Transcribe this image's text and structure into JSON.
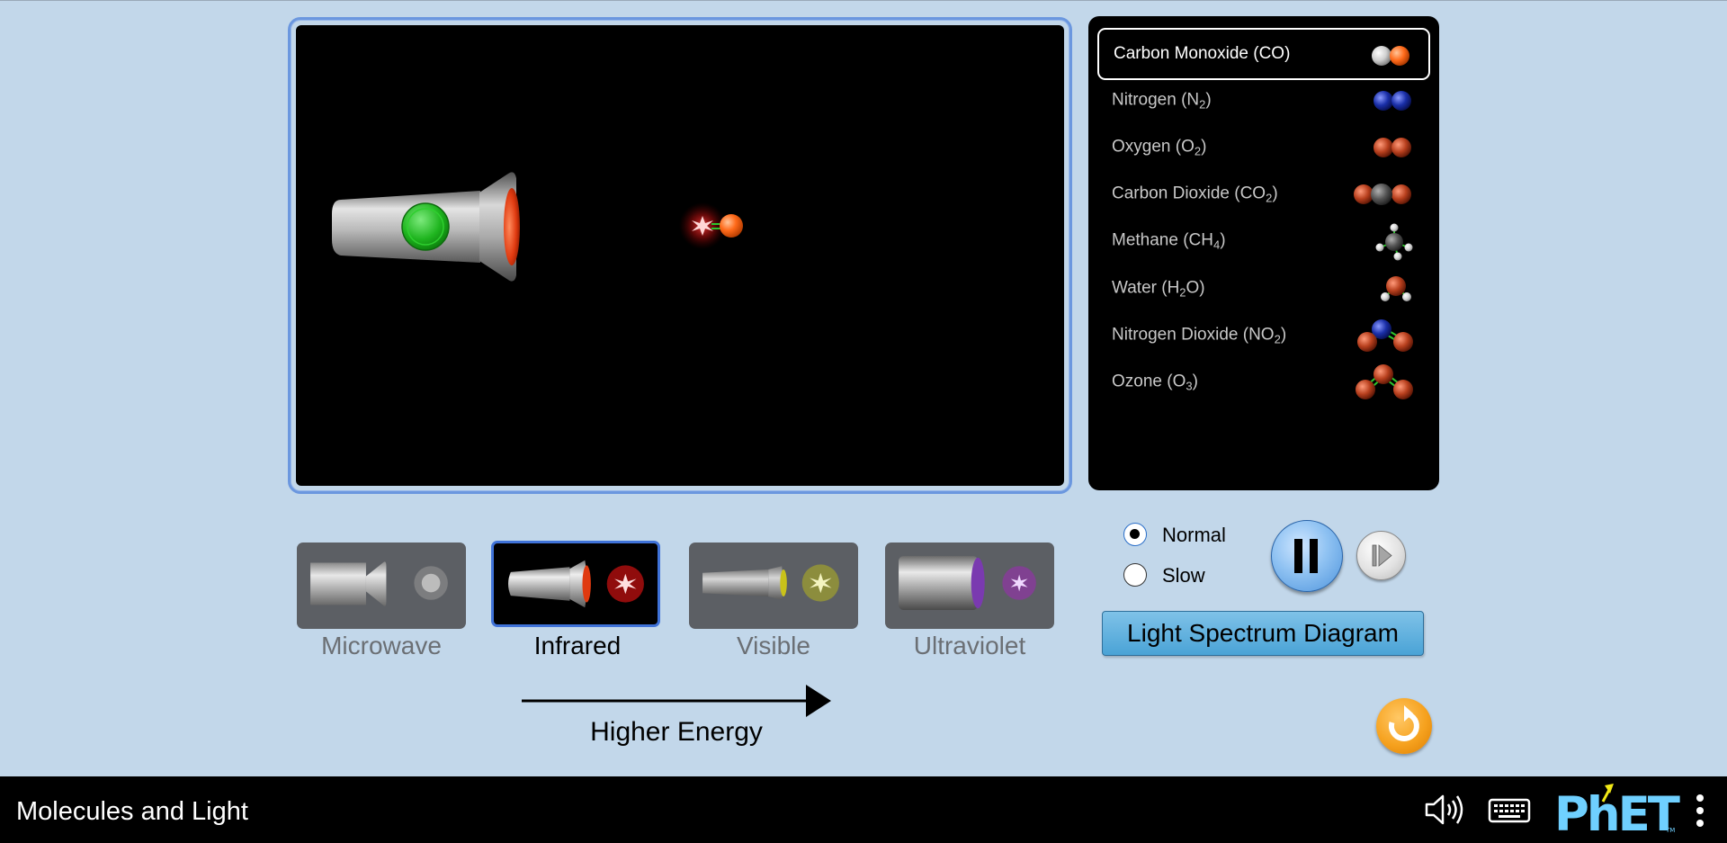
{
  "sim": {
    "title": "Molecules and Light"
  },
  "molecules": [
    {
      "name": "Carbon Monoxide (CO)",
      "base": "Carbon Monoxide (CO)",
      "sub": "",
      "after": "",
      "selected": true,
      "icon": "co-molecule-icon"
    },
    {
      "name": "Nitrogen (N2)",
      "base": "Nitrogen (N",
      "sub": "2",
      "after": ")",
      "selected": false,
      "icon": "n2-molecule-icon"
    },
    {
      "name": "Oxygen (O2)",
      "base": "Oxygen (O",
      "sub": "2",
      "after": ")",
      "selected": false,
      "icon": "o2-molecule-icon"
    },
    {
      "name": "Carbon Dioxide (CO2)",
      "base": "Carbon Dioxide (CO",
      "sub": "2",
      "after": ")",
      "selected": false,
      "icon": "co2-molecule-icon"
    },
    {
      "name": "Methane (CH4)",
      "base": "Methane (CH",
      "sub": "4",
      "after": ")",
      "selected": false,
      "icon": "ch4-molecule-icon"
    },
    {
      "name": "Water (H2O)",
      "base": "Water (H",
      "sub": "2",
      "after": "O)",
      "selected": false,
      "icon": "h2o-molecule-icon"
    },
    {
      "name": "Nitrogen Dioxide (NO2)",
      "base": "Nitrogen Dioxide (NO",
      "sub": "2",
      "after": ")",
      "selected": false,
      "icon": "no2-molecule-icon"
    },
    {
      "name": "Ozone (O3)",
      "base": "Ozone (O",
      "sub": "3",
      "after": ")",
      "selected": false,
      "icon": "o3-molecule-icon"
    }
  ],
  "sources": [
    {
      "label": "Microwave",
      "selected": false,
      "icon": "microwave-source-icon"
    },
    {
      "label": "Infrared",
      "selected": true,
      "icon": "infrared-source-icon"
    },
    {
      "label": "Visible",
      "selected": false,
      "icon": "visible-source-icon"
    },
    {
      "label": "Ultraviolet",
      "selected": false,
      "icon": "ultraviolet-source-icon"
    }
  ],
  "energy": {
    "label": "Higher Energy"
  },
  "speed": {
    "options": [
      "Normal",
      "Slow"
    ],
    "selected": "Normal"
  },
  "controls": {
    "spectrum_button": "Light Spectrum Diagram",
    "playing": true
  },
  "colors": {
    "background": "#c2d7ea",
    "carbon": "#555555",
    "oxygen": "#b8401e",
    "co_oxygen": "#ff6a1a",
    "nitrogen": "#1a2fa8",
    "hydrogen": "#e0e0e0",
    "bond": "#2cc62c",
    "accent_blue": "#3f72d8",
    "reset_orange": "#f6a21f",
    "phet_blue": "#6fd0ff",
    "phet_yellow": "#f2e916"
  }
}
